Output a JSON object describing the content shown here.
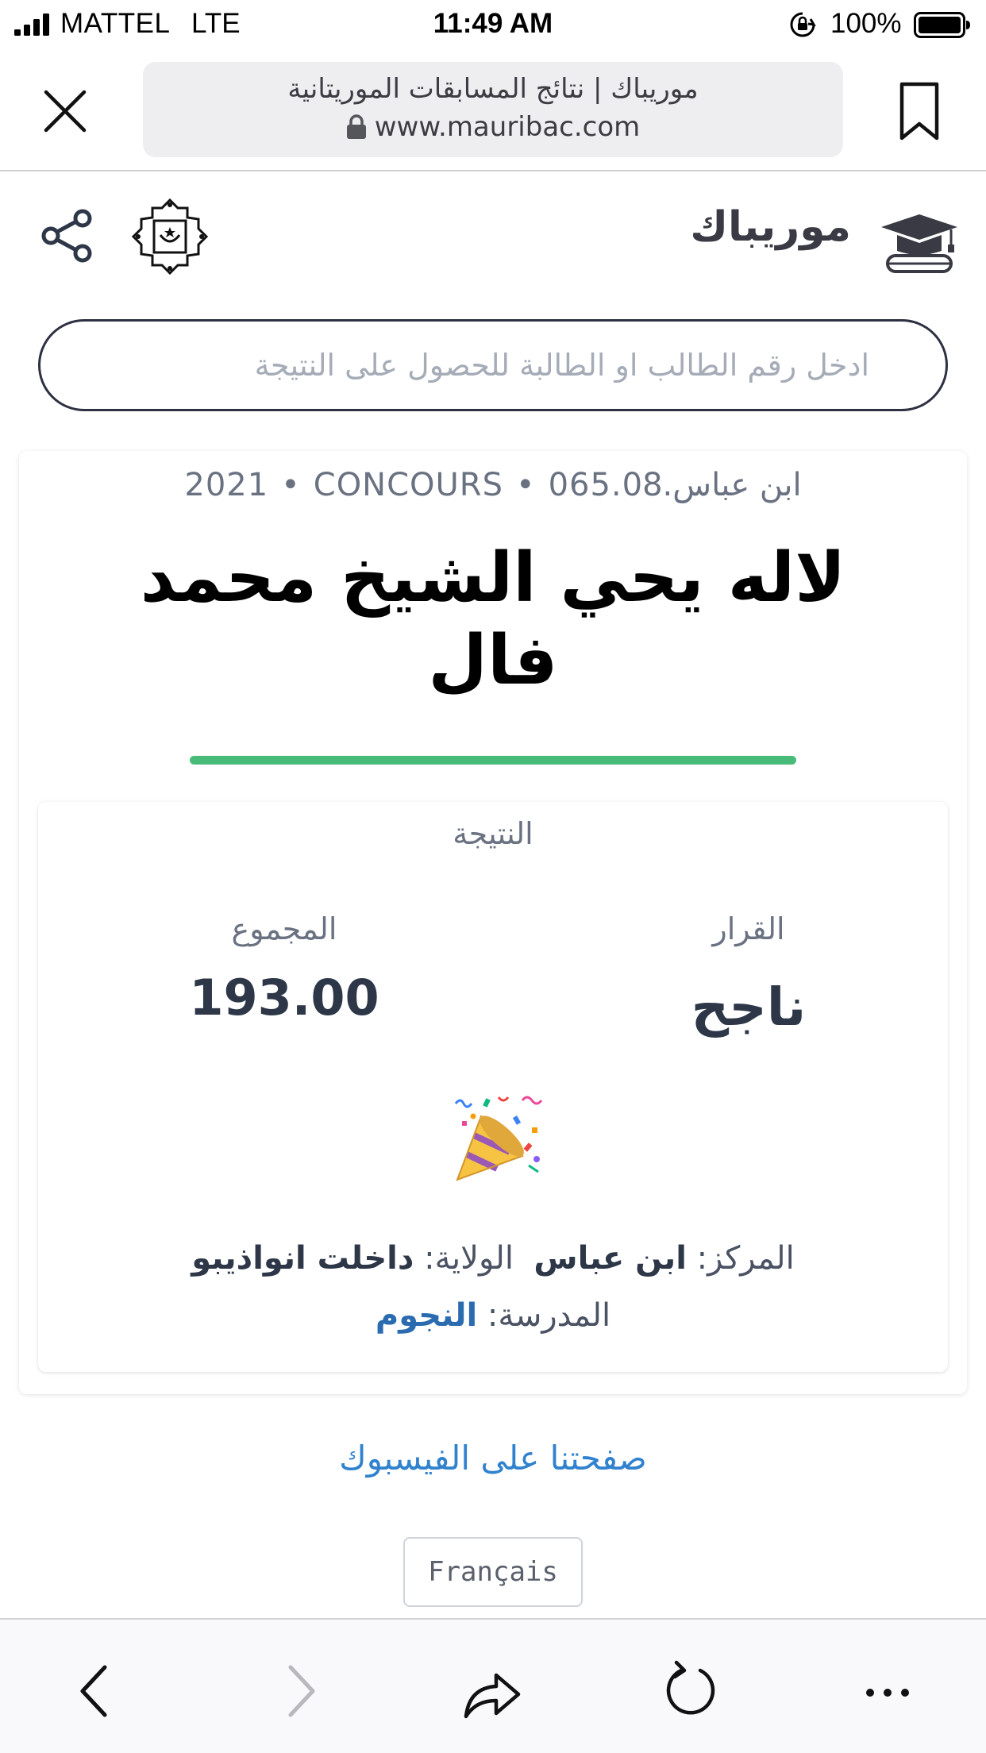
{
  "status_bar": {
    "carrier": "MATTEL",
    "network": "LTE",
    "time": "11:49 AM",
    "battery": "100%"
  },
  "browser": {
    "page_title": "موريباك | نتائج المسابقات الموريتانية",
    "url": "www.mauribac.com"
  },
  "site": {
    "brand": "موريباك",
    "search_placeholder": "ادخل رقم الطالب او الطالبة للحصول على النتيجة"
  },
  "result": {
    "year": "2021",
    "exam": "CONCOURS",
    "center_code": "065.ابن عباس.08",
    "student_name": "لاله يحي الشيخ محمد فال",
    "section_title": "النتيجة",
    "decision_label": "القرار",
    "decision_value": "ناجح",
    "total_label": "المجموع",
    "total_value": "193.00",
    "center_label": "المركز:",
    "center_value": "ابن عباس",
    "state_label": "الولاية:",
    "state_value": "داخلت انواذيبو",
    "school_label": "المدرسة:",
    "school_value": "النجوم"
  },
  "footer": {
    "facebook_link": "صفحتنا على الفيسبوك",
    "language_button": "Français"
  },
  "colors": {
    "accent_green": "#48bb78",
    "link_blue": "#3182ce",
    "dark_text": "#2d3748"
  },
  "icons": [
    "signal-icon",
    "rotation-lock-icon",
    "battery-icon",
    "close-icon",
    "padlock-icon",
    "bookmark-icon",
    "share-icon",
    "emblem-icon",
    "graduation-cap-icon",
    "party-popper-icon",
    "back-icon",
    "forward-icon",
    "share-out-icon",
    "reload-icon",
    "more-icon"
  ]
}
